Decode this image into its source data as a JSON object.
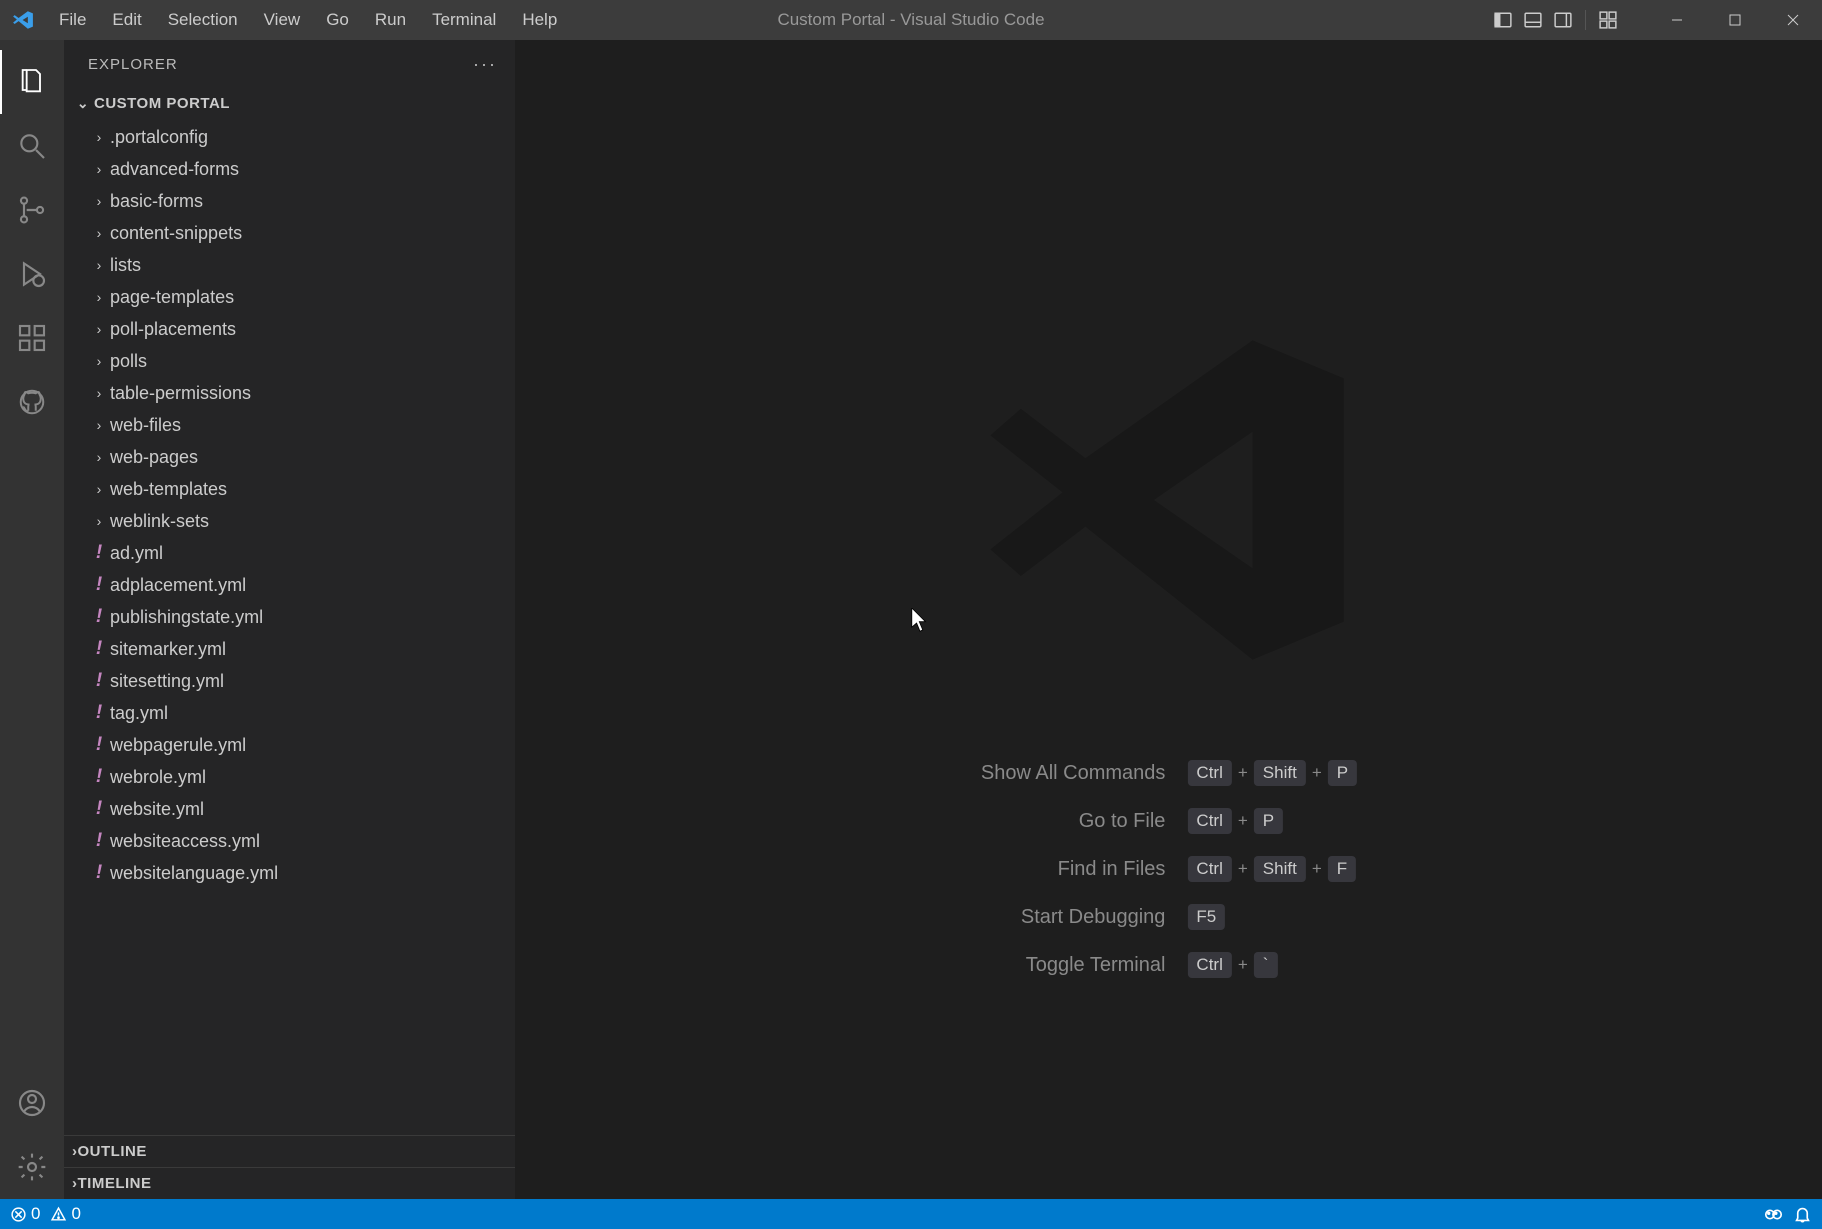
{
  "title": "Custom Portal - Visual Studio Code",
  "menu": [
    "File",
    "Edit",
    "Selection",
    "View",
    "Go",
    "Run",
    "Terminal",
    "Help"
  ],
  "sidebar": {
    "header": "EXPLORER",
    "project": "CUSTOM PORTAL",
    "folders": [
      ".portalconfig",
      "advanced-forms",
      "basic-forms",
      "content-snippets",
      "lists",
      "page-templates",
      "poll-placements",
      "polls",
      "table-permissions",
      "web-files",
      "web-pages",
      "web-templates",
      "weblink-sets"
    ],
    "files": [
      "ad.yml",
      "adplacement.yml",
      "publishingstate.yml",
      "sitemarker.yml",
      "sitesetting.yml",
      "tag.yml",
      "webpagerule.yml",
      "webrole.yml",
      "website.yml",
      "websiteaccess.yml",
      "websitelanguage.yml"
    ],
    "outline": "OUTLINE",
    "timeline": "TIMELINE"
  },
  "shortcuts": [
    {
      "label": "Show All Commands",
      "keys": [
        "Ctrl",
        "Shift",
        "P"
      ]
    },
    {
      "label": "Go to File",
      "keys": [
        "Ctrl",
        "P"
      ]
    },
    {
      "label": "Find in Files",
      "keys": [
        "Ctrl",
        "Shift",
        "F"
      ]
    },
    {
      "label": "Start Debugging",
      "keys": [
        "F5"
      ]
    },
    {
      "label": "Toggle Terminal",
      "keys": [
        "Ctrl",
        "`"
      ]
    }
  ],
  "status": {
    "errors": "0",
    "warnings": "0"
  }
}
